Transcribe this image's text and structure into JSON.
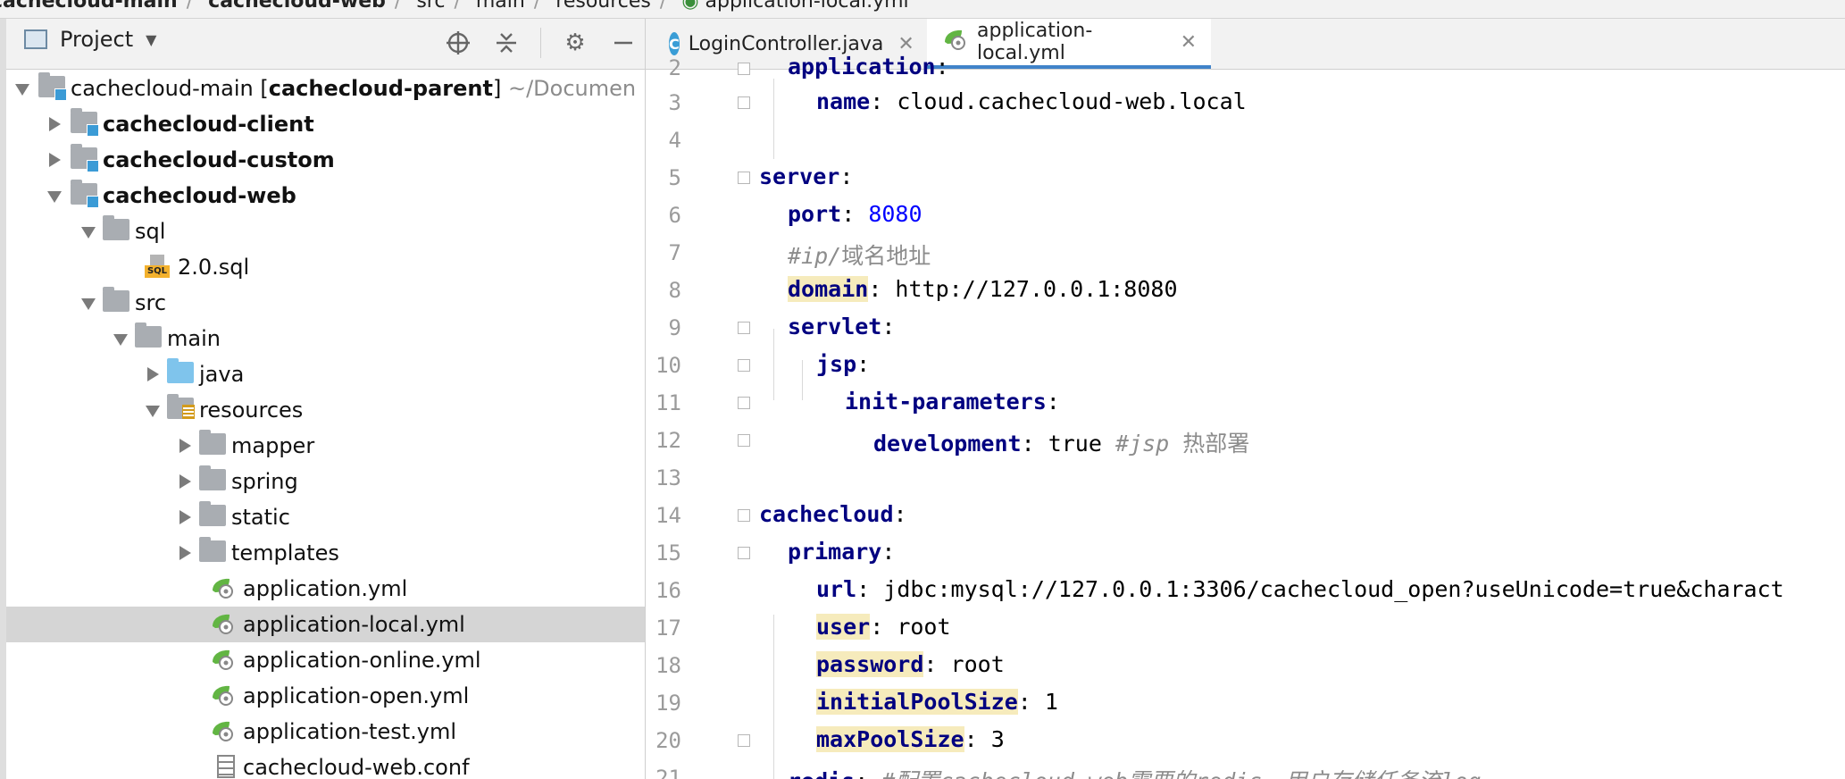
{
  "breadcrumb": {
    "items": [
      "cachecloud-main",
      "cachecloud-web",
      "src",
      "main",
      "resources",
      "application-local.yml"
    ]
  },
  "project_panel": {
    "title": "Project",
    "tree": [
      {
        "label": "cachecloud-main",
        "suffix_bracket": "cachecloud-parent",
        "suffix_path": "~/Documen",
        "kind": "module",
        "expanded": true
      },
      {
        "label": "cachecloud-client",
        "kind": "module",
        "expanded": false
      },
      {
        "label": "cachecloud-custom",
        "kind": "module",
        "expanded": false
      },
      {
        "label": "cachecloud-web",
        "kind": "module",
        "expanded": true
      },
      {
        "label": "sql",
        "kind": "folder",
        "expanded": true
      },
      {
        "label": "2.0.sql",
        "kind": "sql"
      },
      {
        "label": "src",
        "kind": "folder",
        "expanded": true
      },
      {
        "label": "main",
        "kind": "folder",
        "expanded": true
      },
      {
        "label": "java",
        "kind": "source-folder",
        "expanded": false
      },
      {
        "label": "resources",
        "kind": "resources-folder",
        "expanded": true
      },
      {
        "label": "mapper",
        "kind": "folder",
        "expanded": false
      },
      {
        "label": "spring",
        "kind": "folder",
        "expanded": false
      },
      {
        "label": "static",
        "kind": "folder",
        "expanded": false
      },
      {
        "label": "templates",
        "kind": "folder",
        "expanded": false
      },
      {
        "label": "application.yml",
        "kind": "yml"
      },
      {
        "label": "application-local.yml",
        "kind": "yml",
        "selected": true
      },
      {
        "label": "application-online.yml",
        "kind": "yml"
      },
      {
        "label": "application-open.yml",
        "kind": "yml"
      },
      {
        "label": "application-test.yml",
        "kind": "yml"
      },
      {
        "label": "cachecloud-web.conf",
        "kind": "conf"
      }
    ]
  },
  "editor": {
    "tabs": [
      {
        "label": "LoginController.java",
        "icon": "java-class-icon",
        "active": false
      },
      {
        "label": "application-local.yml",
        "icon": "spring-yml-icon",
        "active": true
      }
    ],
    "lines": [
      {
        "n": "2",
        "text": "application:"
      },
      {
        "n": "3",
        "text": "name: cloud.cachecloud-web.local"
      },
      {
        "n": "4",
        "text": ""
      },
      {
        "n": "5",
        "text": "server:"
      },
      {
        "n": "6",
        "text": "port: 8080"
      },
      {
        "n": "7",
        "text": "#ip/域名地址"
      },
      {
        "n": "8",
        "text": "domain: http://127.0.0.1:8080"
      },
      {
        "n": "9",
        "text": "servlet:"
      },
      {
        "n": "10",
        "text": "jsp:"
      },
      {
        "n": "11",
        "text": "init-parameters:"
      },
      {
        "n": "12",
        "text": "development: true #jsp 热部署"
      },
      {
        "n": "13",
        "text": ""
      },
      {
        "n": "14",
        "text": "cachecloud:"
      },
      {
        "n": "15",
        "text": "primary:"
      },
      {
        "n": "16",
        "text": "url: jdbc:mysql://127.0.0.1:3306/cachecloud_open?useUnicode=true&charact"
      },
      {
        "n": "17",
        "text": "user: root"
      },
      {
        "n": "18",
        "text": "password: root"
      },
      {
        "n": "19",
        "text": "initialPoolSize: 1"
      },
      {
        "n": "20",
        "text": "maxPoolSize: 3"
      },
      {
        "n": "21",
        "text": "redis: #配置cachecloud-web需要的redis，用户存储任务流log"
      }
    ],
    "tokens": {
      "l2_key": "application",
      "l3_key": "name",
      "l3_val": " cloud.cachecloud-web.local",
      "l5_key": "server",
      "l6_key": "port",
      "l6_val": "8080",
      "l7_cmt": "#ip/",
      "l7_cmt_cn": "域名地址",
      "l8_key": "domain",
      "l8_val": " http://127.0.0.1:8080",
      "l9_key": "servlet",
      "l10_key": "jsp",
      "l11_key": "init-parameters",
      "l12_key": "development",
      "l12_val": " true ",
      "l12_cmt": "#jsp",
      "l12_cmt_cn": " 热部署",
      "l14_key": "cachecloud",
      "l15_key": "primary",
      "l16_key": "url",
      "l16_val": " jdbc:mysql://127.0.0.1:3306/cachecloud_open?useUnicode=true&charact",
      "l17_key": "user",
      "l17_val": " root",
      "l18_key": "password",
      "l18_val": " root",
      "l19_key": "initialPoolSize",
      "l19_val": " 1",
      "l20_key": "maxPoolSize",
      "l20_val": " 3",
      "l21_key": "redis",
      "l21_cmt": " #配置cachecloud-web需要的redis，用户存储任务流log"
    }
  }
}
